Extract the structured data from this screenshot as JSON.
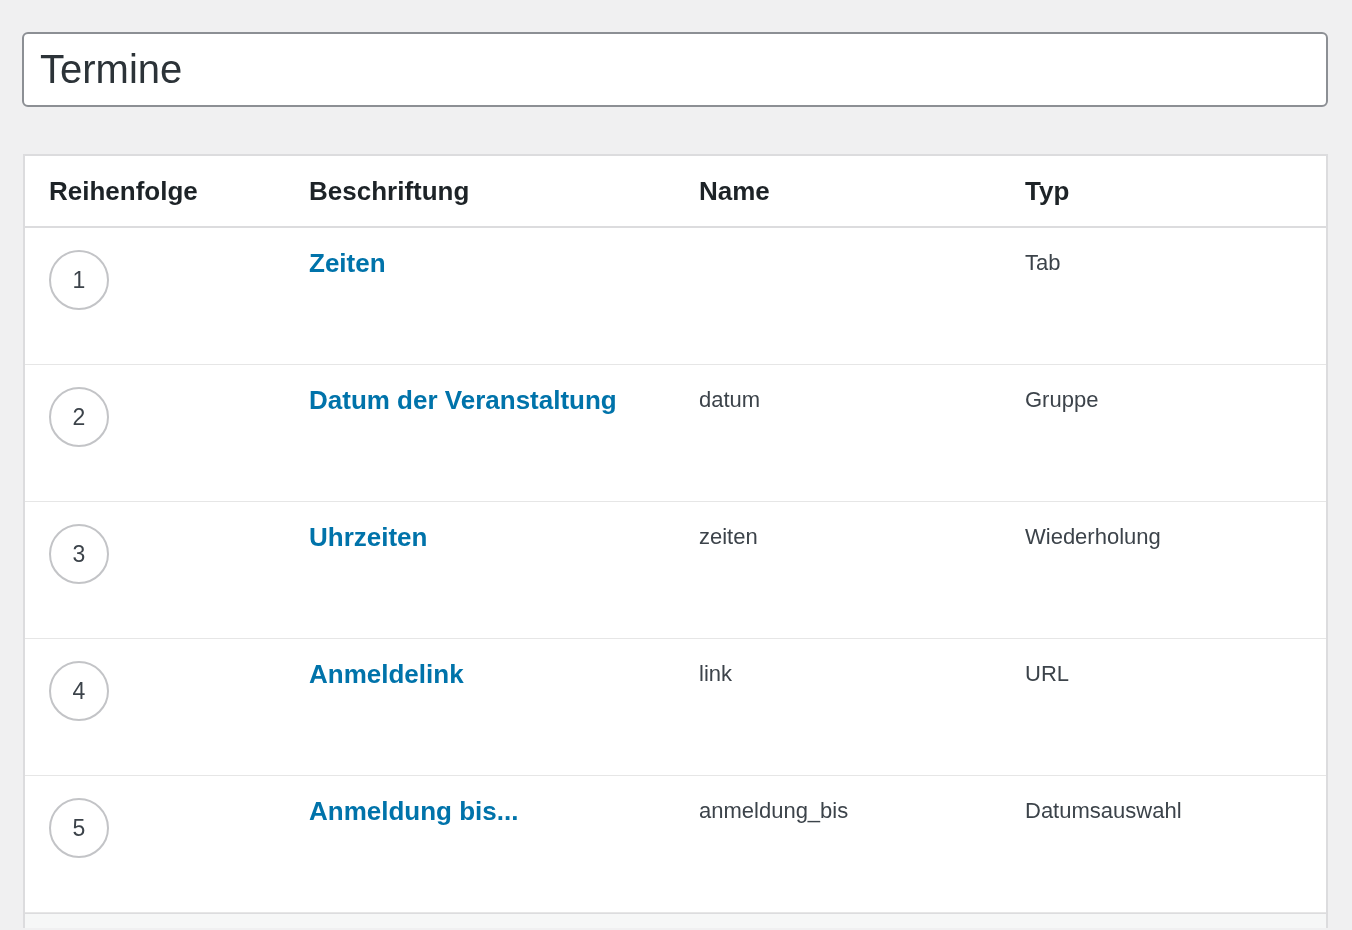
{
  "title_field": {
    "value": "Termine"
  },
  "table": {
    "columns": [
      "Reihenfolge",
      "Beschriftung",
      "Name",
      "Typ"
    ],
    "rows": [
      {
        "order": "1",
        "label": "Zeiten",
        "name": "",
        "type": "Tab"
      },
      {
        "order": "2",
        "label": "Datum der Veranstaltung",
        "name": "datum",
        "type": "Gruppe"
      },
      {
        "order": "3",
        "label": "Uhrzeiten",
        "name": "zeiten",
        "type": "Wiederholung"
      },
      {
        "order": "4",
        "label": "Anmeldelink",
        "name": "link",
        "type": "URL"
      },
      {
        "order": "5",
        "label": "Anmeldung bis...",
        "name": "anmeldung_bis",
        "type": "Datumsauswahl"
      }
    ]
  }
}
